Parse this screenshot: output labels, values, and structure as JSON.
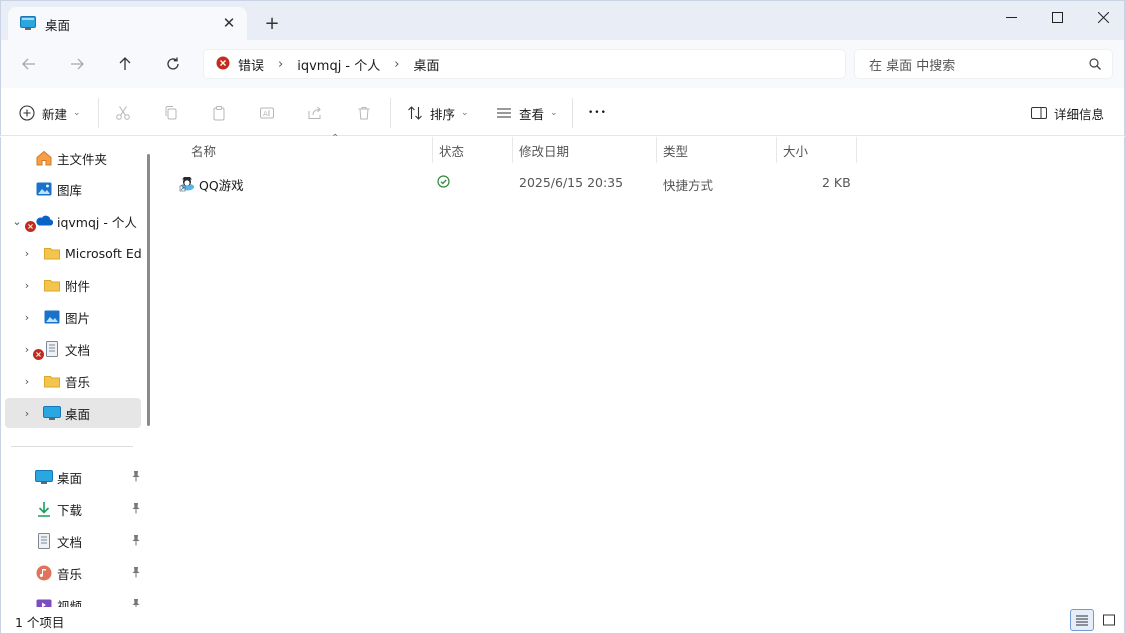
{
  "window": {
    "tab_title": "桌面",
    "close_tab_glyph": "✕",
    "new_tab_glyph": "+"
  },
  "address": {
    "error_crumb": "错误",
    "crumbs": [
      "iqvmqj - 个人",
      "桌面"
    ],
    "separator": "›"
  },
  "search": {
    "placeholder": "在 桌面 中搜索"
  },
  "commands": {
    "new_label": "新建",
    "sort_label": "排序",
    "view_label": "查看",
    "more_glyph": "•••",
    "details_label": "详细信息"
  },
  "sidebar": {
    "items": [
      {
        "label": "主文件夹",
        "icon": "home-icon"
      },
      {
        "label": "图库",
        "icon": "gallery-icon"
      },
      {
        "label": "iqvmqj - 个人",
        "icon": "onedrive-cloud-icon"
      },
      {
        "label": "Microsoft Ed",
        "icon": "folder-icon"
      },
      {
        "label": "附件",
        "icon": "folder-icon"
      },
      {
        "label": "图片",
        "icon": "pictures-icon"
      },
      {
        "label": "文档",
        "icon": "documents-icon"
      },
      {
        "label": "音乐",
        "icon": "folder-icon"
      },
      {
        "label": "桌面",
        "icon": "desktop-icon"
      }
    ],
    "quick_access": [
      {
        "label": "桌面",
        "icon": "desktop-icon"
      },
      {
        "label": "下载",
        "icon": "download-icon"
      },
      {
        "label": "文档",
        "icon": "documents-icon"
      },
      {
        "label": "音乐",
        "icon": "music-icon"
      },
      {
        "label": "视频",
        "icon": "video-icon"
      }
    ],
    "pin_glyph": "📌"
  },
  "columns": {
    "name": "名称",
    "status": "状态",
    "modified": "修改日期",
    "type": "类型",
    "size": "大小"
  },
  "files": [
    {
      "name": "QQ游戏",
      "modified": "2025/6/15 20:35",
      "type": "快捷方式",
      "size": "2 KB",
      "status": "synced"
    }
  ],
  "statusbar": {
    "item_count": "1 个项目"
  },
  "colors": {
    "accent": "#0067c0",
    "error": "#c42b1c",
    "sync_ok": "#2f8a3c",
    "folder": "#f4c54d"
  }
}
